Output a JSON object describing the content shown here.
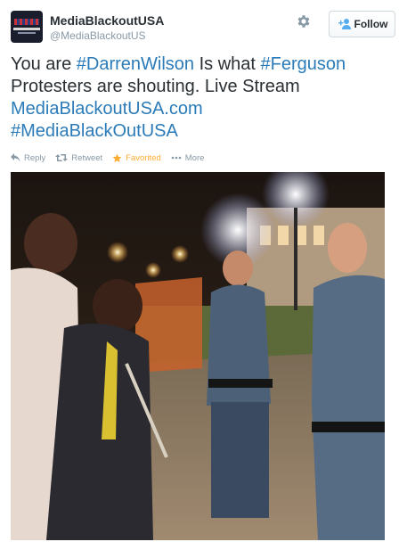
{
  "header": {
    "display_name": "MediaBlackoutUSA",
    "screen_name": "@MediaBlackoutUS",
    "follow_label": "Follow",
    "avatar_icon": "media-blackout-flag-logo",
    "gear_icon": "gear-icon"
  },
  "tweet": {
    "segments": {
      "s1": "You are ",
      "s2": "#DarrenWilson",
      "s3": " Is what ",
      "s4": "#Ferguson",
      "s5": "Protesters are shouting. Live Stream",
      "s6": "MediaBlackoutUSA.com",
      "s7": "#MediaBlackOutUSA"
    }
  },
  "actions": {
    "reply": "Reply",
    "retweet": "Retweet",
    "favorite": "Favorited",
    "more": "More"
  },
  "colors": {
    "link": "#2b7bb9",
    "favorited": "#ffac33",
    "muted": "#8899a6",
    "follow_icon": "#55acee"
  },
  "media": {
    "description_icon": "photo-protest-police-night"
  }
}
